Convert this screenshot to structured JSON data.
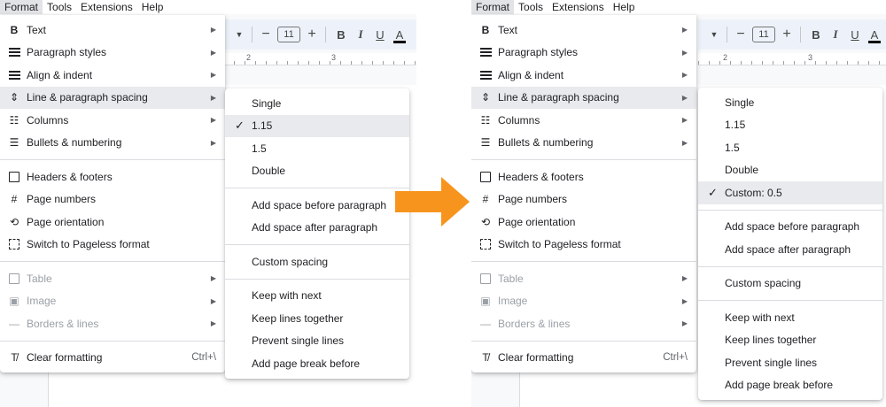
{
  "menubar": [
    "Format",
    "Tools",
    "Extensions",
    "Help"
  ],
  "toolbar": {
    "font_size": "11",
    "minus": "−",
    "plus": "+",
    "bold": "B",
    "italic": "I",
    "underline": "U",
    "color": "A"
  },
  "ruler": {
    "labels": [
      "2",
      "3"
    ]
  },
  "format_menu": {
    "items": [
      {
        "label": "Text",
        "icon": "bold-icon"
      },
      {
        "label": "Paragraph styles",
        "icon": "paragraph-styles-icon"
      },
      {
        "label": "Align & indent",
        "icon": "align-icon"
      },
      {
        "label": "Line & paragraph spacing",
        "icon": "line-spacing-icon"
      },
      {
        "label": "Columns",
        "icon": "columns-icon"
      },
      {
        "label": "Bullets & numbering",
        "icon": "bullets-icon"
      },
      {
        "label": "Headers & footers",
        "icon": "headers-footers-icon"
      },
      {
        "label": "Page numbers",
        "icon": "hash-icon"
      },
      {
        "label": "Page orientation",
        "icon": "page-orientation-icon"
      },
      {
        "label": "Switch to Pageless format",
        "icon": "pageless-icon"
      },
      {
        "label": "Table",
        "icon": "table-icon"
      },
      {
        "label": "Image",
        "icon": "image-icon"
      },
      {
        "label": "Borders & lines",
        "icon": "borders-icon"
      },
      {
        "label": "Clear formatting",
        "icon": "clear-formatting-icon",
        "shortcut": "Ctrl+\\"
      }
    ]
  },
  "spacing_menu_left": {
    "options": [
      "Single",
      "1.15",
      "1.5",
      "Double"
    ],
    "selected": "1.15",
    "paragraph": [
      "Add space before paragraph",
      "Add space after paragraph"
    ],
    "custom": "Custom spacing",
    "keep": [
      "Keep with next",
      "Keep lines together",
      "Prevent single lines",
      "Add page break before"
    ]
  },
  "spacing_menu_right": {
    "options": [
      "Single",
      "1.15",
      "1.5",
      "Double",
      "Custom: 0.5"
    ],
    "selected": "Custom: 0.5",
    "paragraph": [
      "Add space before paragraph",
      "Add space after paragraph"
    ],
    "custom": "Custom spacing",
    "keep": [
      "Keep with next",
      "Keep lines together",
      "Prevent single lines",
      "Add page break before"
    ]
  },
  "colors": {
    "arrow": "#f7941d",
    "hover": "#e8eaed"
  }
}
